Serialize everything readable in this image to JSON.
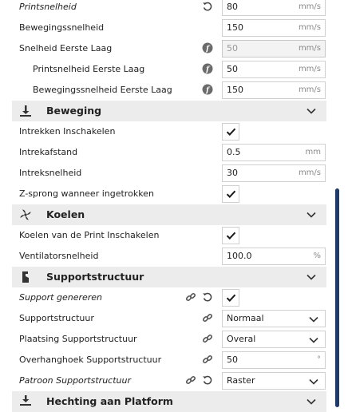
{
  "rows": [
    {
      "type": "setting",
      "label": "Printsnelheid",
      "italic": true,
      "value": "80",
      "unit": "mm/s",
      "icons": [
        "reset-icon"
      ]
    },
    {
      "type": "setting",
      "label": "Bewegingssnelheid",
      "value": "150",
      "unit": "mm/s"
    },
    {
      "type": "setting",
      "label": "Snelheid Eerste Laag",
      "value": "50",
      "unit": "mm/s",
      "disabled": true,
      "icons": [
        "function-icon"
      ]
    },
    {
      "type": "setting",
      "label": "Printsnelheid Eerste Laag",
      "indent": true,
      "value": "50",
      "unit": "mm/s",
      "icons": [
        "function-icon"
      ]
    },
    {
      "type": "setting",
      "label": "Bewegingssnelheid Eerste Laag",
      "indent": true,
      "value": "150",
      "unit": "mm/s",
      "icons": [
        "function-icon"
      ]
    },
    {
      "type": "category",
      "label": "Beweging",
      "icon": "travel-icon"
    },
    {
      "type": "check",
      "label": "Intrekken Inschakelen",
      "checked": true
    },
    {
      "type": "setting",
      "label": "Intrekafstand",
      "value": "0.5",
      "unit": "mm"
    },
    {
      "type": "setting",
      "label": "Intreksnelheid",
      "value": "30",
      "unit": "mm/s"
    },
    {
      "type": "check",
      "label": "Z-sprong wanneer ingetrokken",
      "checked": true
    },
    {
      "type": "category",
      "label": "Koelen",
      "icon": "fan-icon"
    },
    {
      "type": "check",
      "label": "Koelen van de Print Inschakelen",
      "checked": true
    },
    {
      "type": "setting",
      "label": "Ventilatorsnelheid",
      "value": "100.0",
      "unit": "%"
    },
    {
      "type": "category",
      "label": "Supportstructuur",
      "icon": "support-icon"
    },
    {
      "type": "check",
      "label": "Support genereren",
      "italic": true,
      "checked": true,
      "icons": [
        "link-icon",
        "reset-icon"
      ]
    },
    {
      "type": "select",
      "label": "Supportstructuur",
      "value": "Normaal",
      "icons": [
        "link-icon"
      ]
    },
    {
      "type": "select",
      "label": "Plaatsing Supportstructuur",
      "value": "Overal",
      "icons": [
        "link-icon"
      ]
    },
    {
      "type": "setting",
      "label": "Overhanghoek Supportstructuur",
      "value": "50",
      "unit": "°",
      "icons": [
        "link-icon"
      ]
    },
    {
      "type": "select",
      "label": "Patroon Supportstructuur",
      "italic": true,
      "value": "Raster",
      "icons": [
        "link-icon",
        "reset-icon"
      ]
    },
    {
      "type": "category",
      "label": "Hechting aan Platform",
      "icon": "adhesion-icon"
    }
  ],
  "colors": {
    "category_bg": "#ececec",
    "scrollbar": "#1f3b6b",
    "field_border": "#d0d0d0"
  }
}
